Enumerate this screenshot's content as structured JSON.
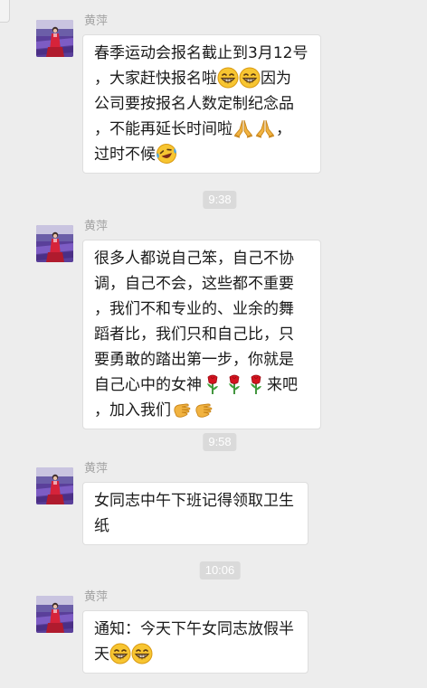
{
  "chat": {
    "messages": [
      {
        "sender": "黄萍",
        "lines": [
          [
            {
              "t": "春季运动会报名截止到3月12号"
            }
          ],
          [
            {
              "t": "，大家赶快报名啦"
            },
            {
              "e": "grin"
            },
            {
              "e": "grin"
            },
            {
              "t": "因为"
            }
          ],
          [
            {
              "t": "公司要按报名人数定制纪念品"
            }
          ],
          [
            {
              "t": "，不能再延长时间啦"
            },
            {
              "e": "pray"
            },
            {
              "e": "pray"
            },
            {
              "t": "，"
            }
          ],
          [
            {
              "t": "过时不候"
            },
            {
              "e": "laugh-tears"
            }
          ]
        ]
      },
      {
        "timestamp": "9:38",
        "sender": "黄萍",
        "lines": [
          [
            {
              "t": "很多人都说自己笨，自己不协"
            }
          ],
          [
            {
              "t": "调，自己不会，这些都不重要"
            }
          ],
          [
            {
              "t": "，我们不和专业的、业余的舞"
            }
          ],
          [
            {
              "t": "蹈者比，我们只和自己比，只"
            }
          ],
          [
            {
              "t": "要勇敢的踏出第一步，你就是"
            }
          ],
          [
            {
              "t": "自己心中的女神"
            },
            {
              "e": "rose"
            },
            {
              "e": "rose"
            },
            {
              "e": "rose"
            },
            {
              "t": "来吧"
            }
          ],
          [
            {
              "t": "，加入我们"
            },
            {
              "e": "beckon"
            },
            {
              "e": "beckon"
            }
          ]
        ]
      },
      {
        "timestamp": "9:58",
        "sender": "黄萍",
        "lines": [
          [
            {
              "t": "女同志中午下班记得领取卫生"
            }
          ],
          [
            {
              "t": "纸"
            }
          ]
        ]
      },
      {
        "timestamp": "10:06",
        "sender": "黄萍",
        "lines": [
          [
            {
              "t": "通知：今天下午女同志放假半"
            }
          ],
          [
            {
              "t": "天"
            },
            {
              "e": "grin"
            },
            {
              "e": "grin"
            }
          ]
        ]
      }
    ]
  }
}
